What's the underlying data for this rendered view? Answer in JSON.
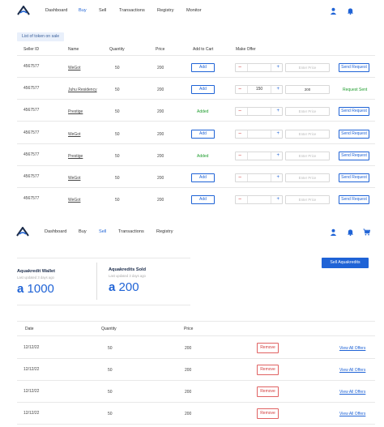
{
  "nav1": {
    "links": [
      "Dashboard",
      "Buy",
      "Sell",
      "Transactions",
      "Registry",
      "Monitor"
    ],
    "active_index": 1
  },
  "tab_pill": "List of token on sale",
  "offers_table": {
    "headers": [
      "Seller ID",
      "Name",
      "Quantity",
      "Price",
      "Add to Cart",
      "Make Offer"
    ],
    "add_label": "Add",
    "added_label": "Added",
    "send_label": "Send Request",
    "sent_label": "Request Sent",
    "price_placeholder": "Enter Price",
    "rows": [
      {
        "seller_id": "4567577",
        "name": "WeGot",
        "quantity": "50",
        "price": "200",
        "cart": "add",
        "offer_qty": "",
        "offer_price": "",
        "request": "send"
      },
      {
        "seller_id": "4567577",
        "name": "Juhu Residency",
        "quantity": "50",
        "price": "200",
        "cart": "add",
        "offer_qty": "150",
        "offer_price": "200",
        "request": "sent"
      },
      {
        "seller_id": "4567577",
        "name": "Prestige",
        "quantity": "50",
        "price": "200",
        "cart": "added",
        "offer_qty": "",
        "offer_price": "",
        "request": "send"
      },
      {
        "seller_id": "4567577",
        "name": "WeGot",
        "quantity": "50",
        "price": "200",
        "cart": "add",
        "offer_qty": "",
        "offer_price": "",
        "request": "send"
      },
      {
        "seller_id": "4567577",
        "name": "Prestige",
        "quantity": "50",
        "price": "200",
        "cart": "added",
        "offer_qty": "",
        "offer_price": "",
        "request": "send"
      },
      {
        "seller_id": "4567577",
        "name": "WeGot",
        "quantity": "50",
        "price": "200",
        "cart": "add",
        "offer_qty": "",
        "offer_price": "",
        "request": "send"
      },
      {
        "seller_id": "4567577",
        "name": "WeGot",
        "quantity": "50",
        "price": "200",
        "cart": "add",
        "offer_qty": "",
        "offer_price": "",
        "request": "send"
      }
    ]
  },
  "nav2": {
    "links": [
      "Dashboard",
      "Buy",
      "Sell",
      "Transactions",
      "Registry"
    ],
    "active_index": 2
  },
  "wallet": {
    "label": "Aquakredit Wallet",
    "updated": "Last updated 3 days ago",
    "symbol": "a",
    "amount": "1000"
  },
  "sold": {
    "label": "Aquakredits Sold",
    "updated": "Last updated 3 days ago",
    "symbol": "a",
    "amount": "200"
  },
  "sell_button": "Sell Aquakredits",
  "listings_table": {
    "headers": [
      "Date",
      "Quantity",
      "Price"
    ],
    "remove_label": "Remove",
    "view_label": "View All Offers",
    "rows": [
      {
        "date": "12/12/22",
        "quantity": "50",
        "price": "200"
      },
      {
        "date": "12/12/22",
        "quantity": "50",
        "price": "200"
      },
      {
        "date": "12/12/22",
        "quantity": "50",
        "price": "200"
      },
      {
        "date": "12/12/22",
        "quantity": "50",
        "price": "200"
      }
    ]
  },
  "colors": {
    "accent": "#1f63d6",
    "success": "#1f9d2e",
    "danger": "#d23c3c"
  }
}
